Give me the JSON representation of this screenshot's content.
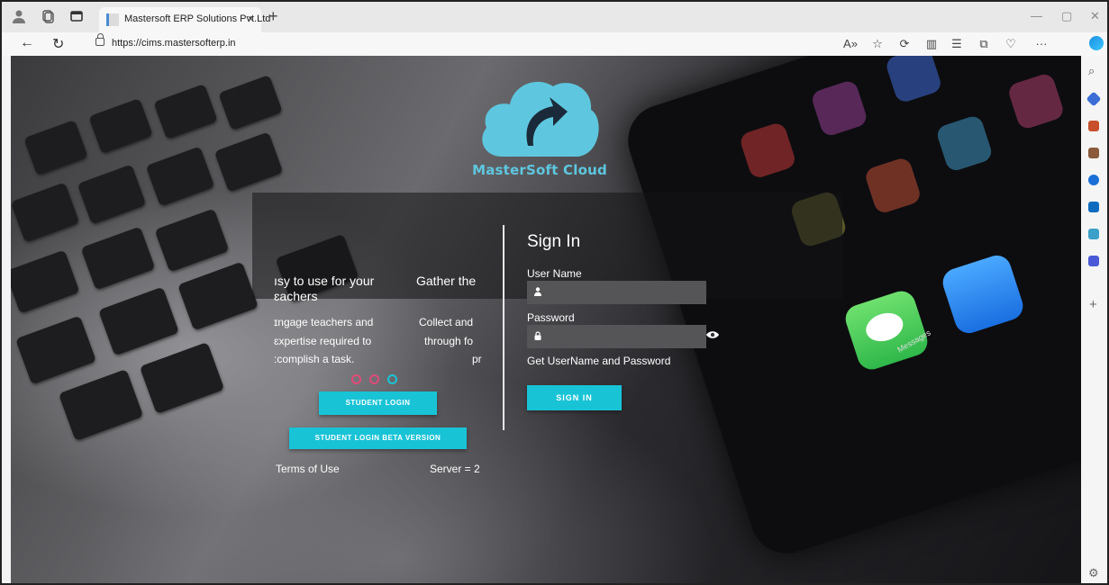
{
  "browser": {
    "tab_title": "Mastersoft ERP Solutions Pvt.Ltd",
    "tab_close": "×",
    "new_tab": "+",
    "url": "https://cims.mastersofterp.in",
    "more_label": "···"
  },
  "colors": {
    "accent": "#19c3d6",
    "logo": "#5ec7df",
    "dot_red": "#e24a78",
    "dot_teal": "#19c3d6"
  },
  "brand": {
    "name": "MasterSoft Cloud",
    "logo_icon": "cloud-arrow-icon"
  },
  "carousel": {
    "slide1_title_line1": "ısy to use for your",
    "slide1_title_line2": "ɛachers",
    "slide1_desc_line1": "ɪngage teachers and",
    "slide1_desc_line2": "ɛxpertise required to",
    "slide1_desc_line3": ":complish a task.",
    "slide2_title": "Gather the",
    "slide2_desc_line1": "Collect and",
    "slide2_desc_line2": "through fo",
    "slide2_desc_line3": "pr"
  },
  "buttons": {
    "student_login": "STUDENT LOGIN",
    "student_login_beta": "STUDENT LOGIN BETA VERSION",
    "sign_in": "SIGN IN"
  },
  "footer": {
    "terms": "Terms of Use",
    "server": "Server = 2"
  },
  "signin": {
    "title": "Sign In",
    "username_label": "User Name",
    "username_value": "",
    "password_label": "Password",
    "password_value": "",
    "get_credentials": "Get UserName and Password"
  }
}
